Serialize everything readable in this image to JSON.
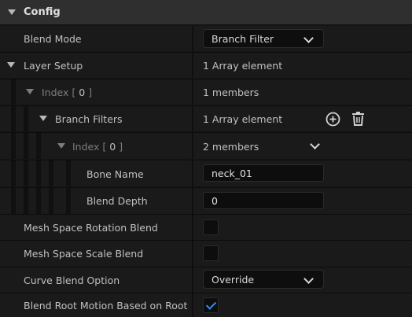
{
  "section": {
    "title": "Config"
  },
  "rows": {
    "blend_mode": {
      "label": "Blend Mode",
      "value": "Branch Filter"
    },
    "layer_setup": {
      "label": "Layer Setup",
      "value": "1 Array element"
    },
    "index0": {
      "label_prefix": "Index [",
      "index": "0",
      "label_suffix": "]",
      "value": "1 members"
    },
    "branch_filters": {
      "label": "Branch Filters",
      "value": "1 Array element",
      "add_icon": "plus-circle-icon",
      "delete_icon": "trash-icon"
    },
    "index0_inner": {
      "label_prefix": "Index [",
      "index": "0",
      "label_suffix": "]",
      "value": "2 members"
    },
    "bone_name": {
      "label": "Bone Name",
      "value": "neck_01"
    },
    "blend_depth": {
      "label": "Blend Depth",
      "value": "0"
    },
    "mesh_rot_blend": {
      "label": "Mesh Space Rotation Blend",
      "checked": false
    },
    "mesh_scale_blend": {
      "label": "Mesh Space Scale Blend",
      "checked": false
    },
    "curve_blend": {
      "label": "Curve Blend Option",
      "value": "Override"
    },
    "root_motion": {
      "label": "Blend Root Motion Based on Root B...",
      "checked": true
    }
  },
  "colors": {
    "background": "#151515",
    "row": "#1a1a1a",
    "header": "#2f2f2f",
    "check_accent": "#2f8cf0"
  }
}
